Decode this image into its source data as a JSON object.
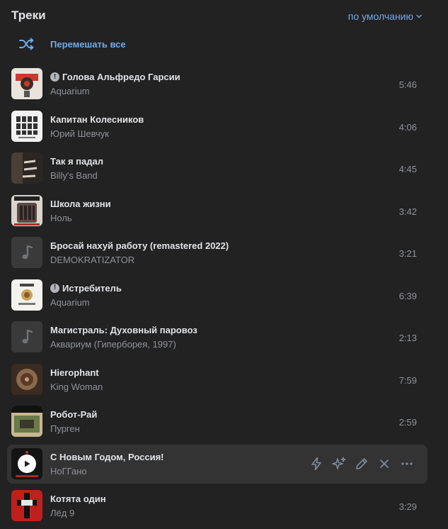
{
  "header": {
    "title": "Треки",
    "sort_label": "по умолчанию"
  },
  "shuffle": {
    "label": "Перемешать все"
  },
  "colors": {
    "accent": "#71aaeb",
    "background": "#222222",
    "active_row": "#333333"
  },
  "tracks": [
    {
      "title": "Голова Альфредо Гарсии",
      "artist": "Aquarium",
      "duration": "5:46",
      "explicit": true,
      "cover": "cover-1"
    },
    {
      "title": "Капитан Колесников",
      "artist": "Юрий Шевчук",
      "duration": "4:06",
      "explicit": false,
      "cover": "cover-2"
    },
    {
      "title": "Так я падал",
      "artist": "Billy's Band",
      "duration": "4:45",
      "explicit": false,
      "cover": "cover-3"
    },
    {
      "title": "Школа жизни",
      "artist": "Ноль",
      "duration": "3:42",
      "explicit": false,
      "cover": "cover-4"
    },
    {
      "title": "Бросай нахуй работу (remastered 2022)",
      "artist": "DEMOKRATIZATOR",
      "duration": "3:21",
      "explicit": false,
      "cover": "note"
    },
    {
      "title": "Истребитель",
      "artist": "Aquarium",
      "duration": "6:39",
      "explicit": true,
      "cover": "cover-6"
    },
    {
      "title": "Магистраль: Духовный паровоз",
      "artist": "Аквариум (Гиперборея, 1997)",
      "duration": "2:13",
      "explicit": false,
      "cover": "note"
    },
    {
      "title": "Hierophant",
      "artist": "King Woman",
      "duration": "7:59",
      "explicit": false,
      "cover": "cover-8"
    },
    {
      "title": "Робот-Рай",
      "artist": "Пурген",
      "duration": "2:59",
      "explicit": false,
      "cover": "cover-9"
    },
    {
      "title": "С Новым Годом, Россия!",
      "artist": "НоГГано",
      "duration": "",
      "explicit": false,
      "cover": "cover-10",
      "active": true
    },
    {
      "title": "Котята один",
      "artist": "Лёд 9",
      "duration": "3:29",
      "explicit": false,
      "cover": "cover-11"
    }
  ],
  "active_actions": [
    "bolt-icon",
    "sparkles-icon",
    "pencil-icon",
    "close-icon",
    "more-icon"
  ]
}
